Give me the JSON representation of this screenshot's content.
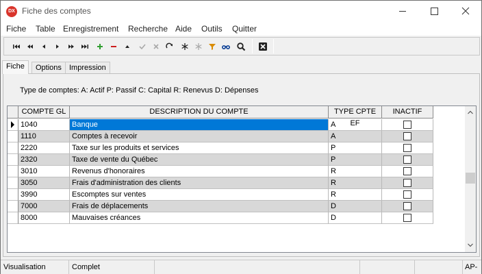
{
  "window": {
    "app_icon_text": "DX",
    "title": "Fiche des comptes"
  },
  "menu": [
    "Fiche",
    "Table",
    "Enregistrement",
    "Recherche",
    "Aide",
    "Outils",
    "Quitter"
  ],
  "toolbar": {
    "buttons": [
      "first-record",
      "previous-page",
      "previous-record",
      "next-record",
      "next-page",
      "last-record",
      "add-record",
      "delete-record",
      "move-up",
      "confirm",
      "cancel-edit",
      "refresh",
      "asterisk",
      "asterisk-disabled",
      "filter",
      "binoculars",
      "search",
      "close-form"
    ],
    "colors": {
      "add": "#2f9e2f",
      "delete": "#cc1d1d",
      "filter": "#d98b00"
    }
  },
  "tabs": [
    "Fiche",
    "Options",
    "Impression"
  ],
  "legend": "Type de comptes:  A: Actif P: Passif C: Capital   R: Renevus D: Dépenses",
  "grid": {
    "columns": [
      "COMPTE GL",
      "DESCRIPTION DU COMPTE",
      "TYPE CPTE EF",
      "INACTIF"
    ],
    "rows": [
      {
        "compte": "1040",
        "description": "Banque",
        "type": "A",
        "inactif": false,
        "selected": true
      },
      {
        "compte": "1110",
        "description": "Comptes à recevoir",
        "type": "A",
        "inactif": false
      },
      {
        "compte": "2220",
        "description": "Taxe sur les produits et services",
        "type": "P",
        "inactif": false
      },
      {
        "compte": "2320",
        "description": "Taxe de vente du Québec",
        "type": "P",
        "inactif": false
      },
      {
        "compte": "3010",
        "description": "Revenus d'honoraires",
        "type": "R",
        "inactif": false
      },
      {
        "compte": "3050",
        "description": "Frais d'administration des clients",
        "type": "R",
        "inactif": false
      },
      {
        "compte": "3990",
        "description": "Escomptes sur ventes",
        "type": "R",
        "inactif": false
      },
      {
        "compte": "7000",
        "description": "Frais de déplacements",
        "type": "D",
        "inactif": false
      },
      {
        "compte": "8000",
        "description": "Mauvaises créances",
        "type": "D",
        "inactif": false
      }
    ],
    "selection_color": "#0078d7"
  },
  "status": [
    "Visualisation",
    "Complet",
    "",
    "",
    "",
    "AP-"
  ]
}
